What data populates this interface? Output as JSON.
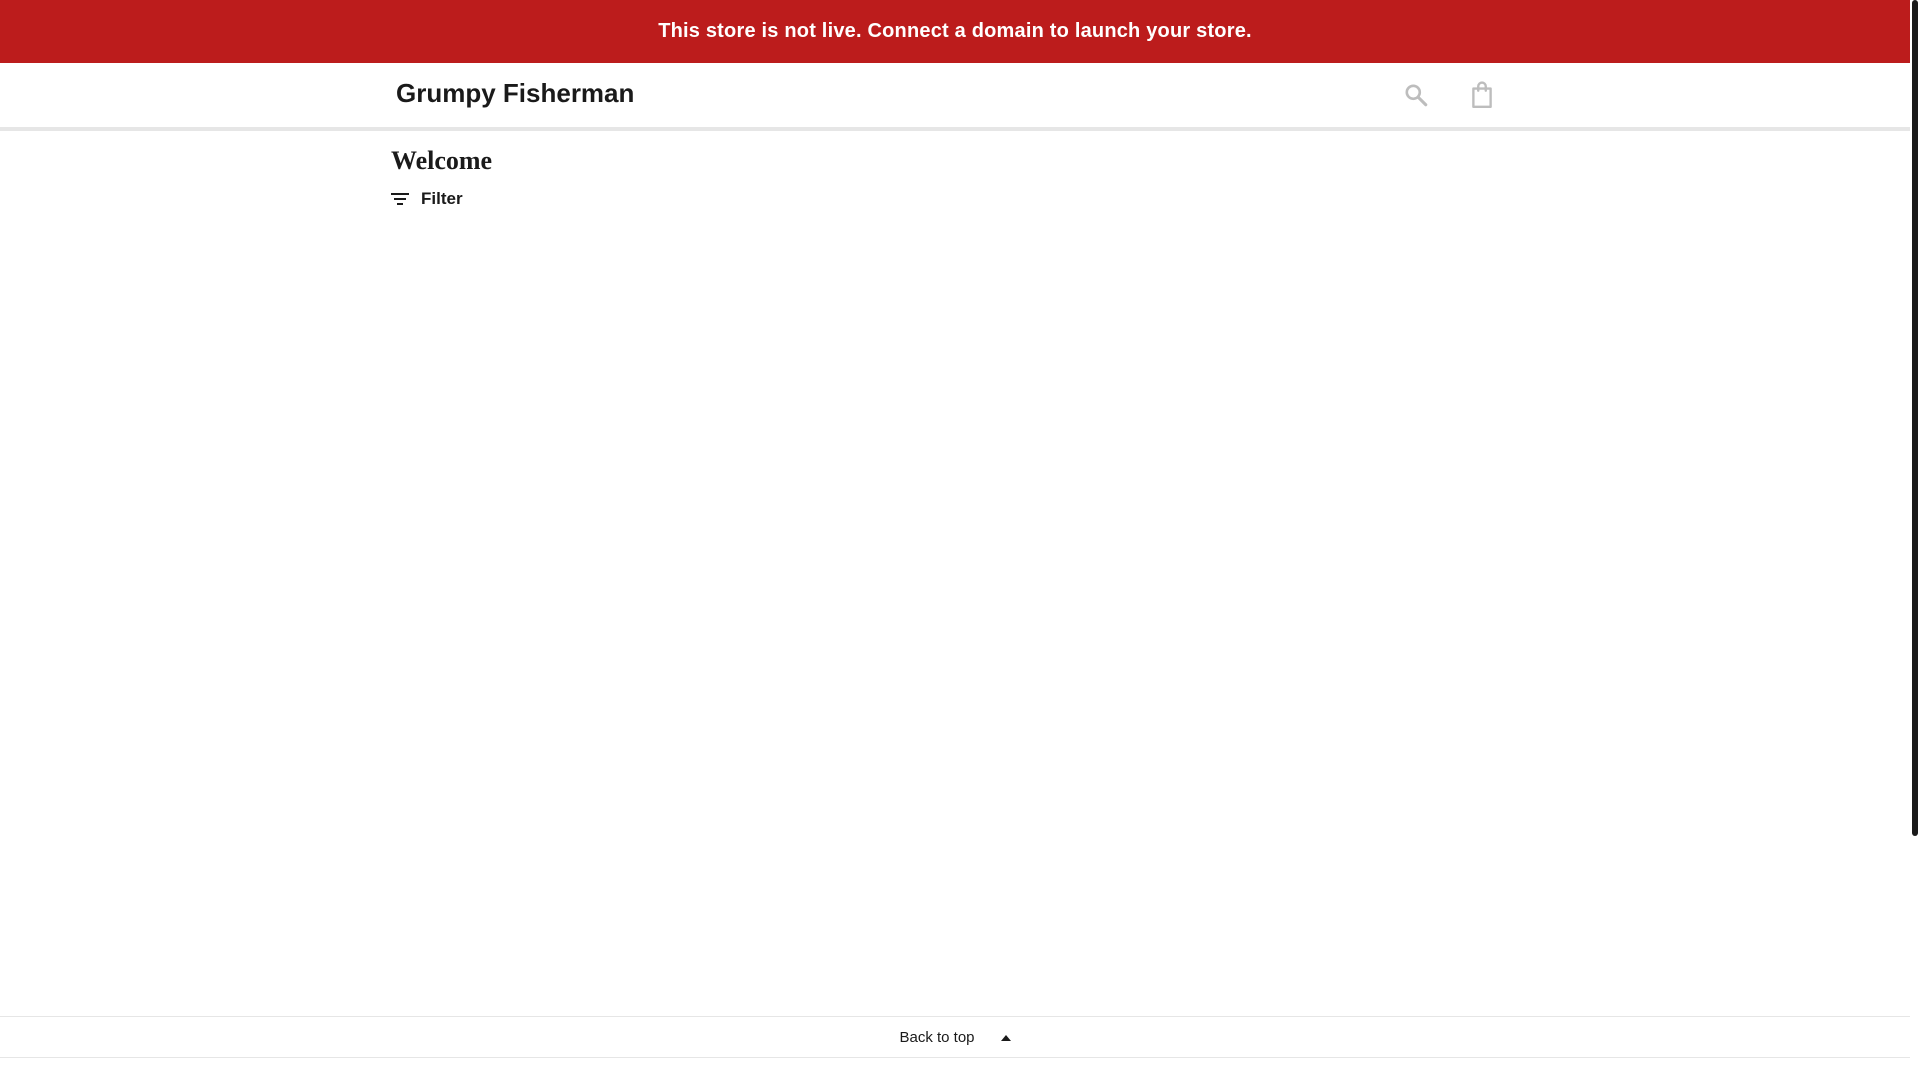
{
  "banner": {
    "text": "This store is not live. Connect a domain to launch your store."
  },
  "header": {
    "store_name": "Grumpy Fisherman",
    "icons": {
      "search": "search-icon",
      "cart": "shopping-bag-icon"
    }
  },
  "main": {
    "title": "Welcome",
    "filter_label": "Filter"
  },
  "footer": {
    "back_to_top_label": "Back to top"
  },
  "colors": {
    "banner_bg": "#bc1c1c",
    "banner_text": "#ffffff",
    "text_primary": "#1a1a1a",
    "icon_muted": "#bdbdbd",
    "divider": "#e6e6e6"
  }
}
